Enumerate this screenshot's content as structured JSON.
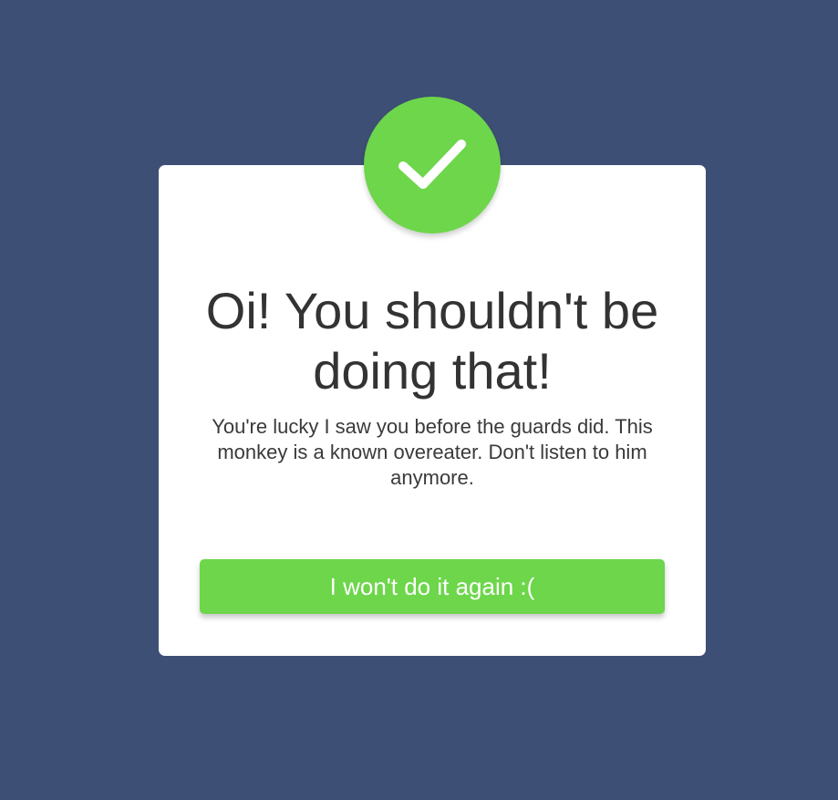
{
  "colors": {
    "background": "#3d4f75",
    "card": "#ffffff",
    "accent": "#6dd64b",
    "title_text": "#333333",
    "message_text": "#3a3a3a"
  },
  "dialog": {
    "icon": "checkmark-icon",
    "title": "Oi! You shouldn't be doing that!",
    "message": "You're lucky I saw you before the guards did. This monkey is a known overeater. Don't listen to him anymore.",
    "button_label": "I won't do it again :("
  }
}
